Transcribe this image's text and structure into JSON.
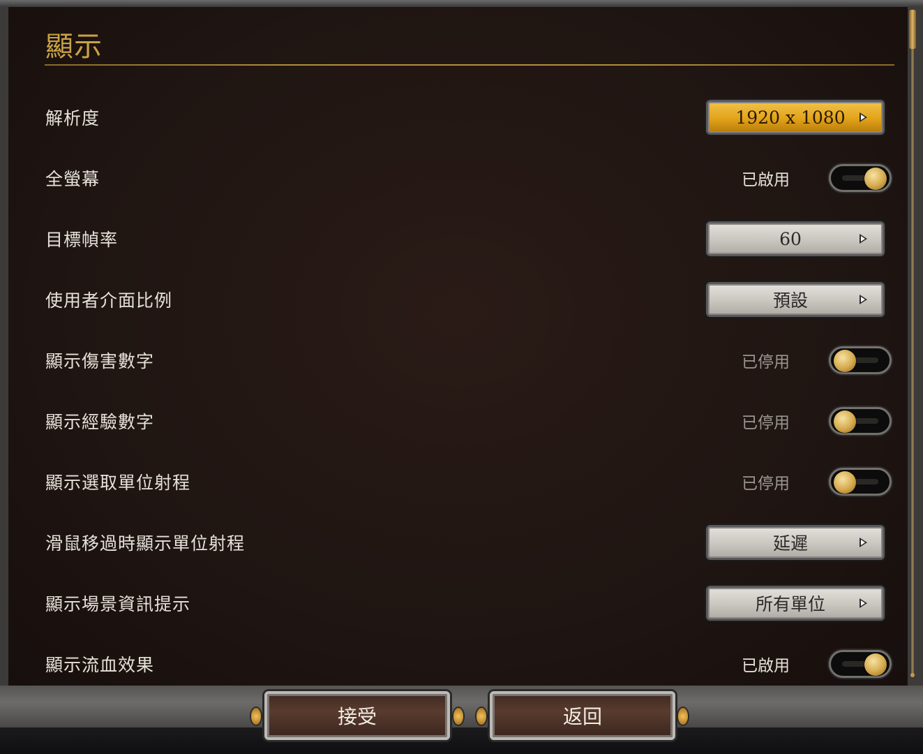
{
  "page": {
    "title": "顯示"
  },
  "rows": [
    {
      "label": "解析度",
      "type": "select",
      "value": "1920 x 1080",
      "style": "gold"
    },
    {
      "label": "全螢幕",
      "type": "toggle",
      "state_text": "已啟用",
      "on": true
    },
    {
      "label": "目標幀率",
      "type": "select",
      "value": "60"
    },
    {
      "label": "使用者介面比例",
      "type": "select",
      "value": "預設"
    },
    {
      "label": "顯示傷害數字",
      "type": "toggle",
      "state_text": "已停用",
      "on": false
    },
    {
      "label": "顯示經驗數字",
      "type": "toggle",
      "state_text": "已停用",
      "on": false
    },
    {
      "label": "顯示選取單位射程",
      "type": "toggle",
      "state_text": "已停用",
      "on": false
    },
    {
      "label": "滑鼠移過時顯示單位射程",
      "type": "select",
      "value": "延遲"
    },
    {
      "label": "顯示場景資訊提示",
      "type": "select",
      "value": "所有單位"
    },
    {
      "label": "顯示流血效果",
      "type": "toggle",
      "state_text": "已啟用",
      "on": true
    }
  ],
  "buttons": {
    "accept": "接受",
    "back": "返回"
  },
  "colors": {
    "accent_gold": "#c9a246",
    "panel_bg": "#1f1512"
  }
}
